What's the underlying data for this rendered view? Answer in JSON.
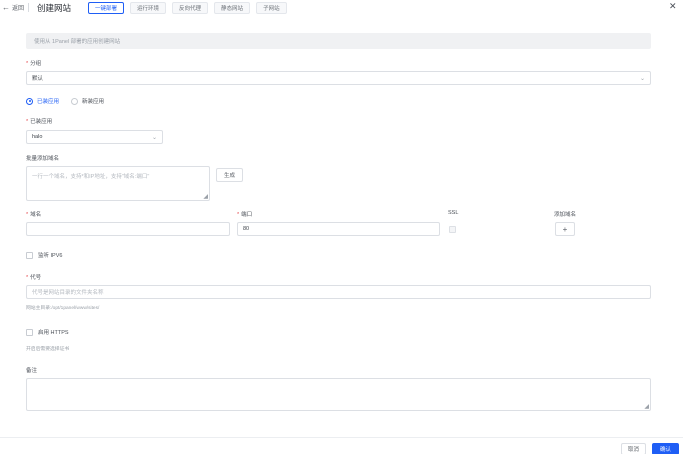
{
  "header": {
    "back_label": "返回",
    "title": "创建网站",
    "tabs": [
      {
        "label": "一键部署",
        "active": true
      },
      {
        "label": "运行环境",
        "active": false
      },
      {
        "label": "反向代理",
        "active": false
      },
      {
        "label": "静态网站",
        "active": false
      },
      {
        "label": "子网站",
        "active": false
      }
    ]
  },
  "form": {
    "info": "使用从 1Panel 部署的应用创建网站",
    "group_label": "分组",
    "group_value": "默认",
    "app_mode": {
      "options": [
        "已装应用",
        "新装应用"
      ],
      "selected": "已装应用"
    },
    "installed_app_label": "已装应用",
    "installed_app_value": "halo",
    "batch_domain_label": "批量添加域名",
    "batch_domain_placeholder": "一行一个域名，支持*和IP地址，支持\"域名:端口\"",
    "generate_button": "生成",
    "domain_label": "域名",
    "domain_value": "",
    "port_label": "端口",
    "port_value": "80",
    "ssl_label": "SSL",
    "add_domain_label": "添加域名",
    "add_button": "+",
    "ipv6_label": "监听 IPV6",
    "alias_label": "代号",
    "alias_placeholder": "代号是网站目录的文件夹名称",
    "alias_hint": "网站主目录:/opt/1panel/www/sites/",
    "https_label": "启用 HTTPS",
    "https_hint": "开启后需要选择证书",
    "remark_label": "备注",
    "remark_value": ""
  },
  "footer": {
    "cancel": "取消",
    "confirm": "确认"
  },
  "colors": {
    "primary": "#1f5ef5",
    "required": "#e5484d"
  }
}
